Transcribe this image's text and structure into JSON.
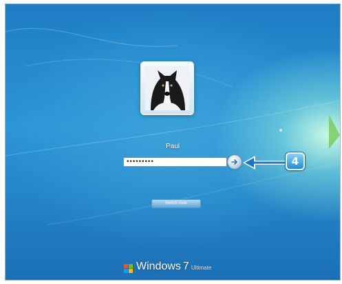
{
  "login": {
    "user_name": "Paul",
    "password_masked": "•••••••••",
    "switch_user_label": "Switch User"
  },
  "annotation": {
    "step_number": "4"
  },
  "branding": {
    "product": "Windows",
    "version": "7",
    "edition": "Ultimate"
  },
  "icons": {
    "user_picture": "dog-photo",
    "submit": "arrow-right-icon",
    "logo": "windows-logo-icon"
  },
  "colors": {
    "background_blue": "#1e7cc4",
    "callout_blue": "#1f8fd8",
    "arrow_blue": "#1a73c9"
  }
}
